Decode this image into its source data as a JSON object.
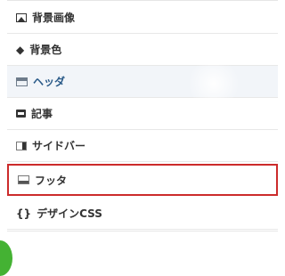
{
  "menu": {
    "items": [
      {
        "label": "背景画像",
        "icon": "image-icon"
      },
      {
        "label": "背景色",
        "icon": "paint-bucket-icon"
      },
      {
        "label": "ヘッダ",
        "icon": "header-layout-icon",
        "active": true
      },
      {
        "label": "記事",
        "icon": "article-icon"
      },
      {
        "label": "サイドバー",
        "icon": "sidebar-layout-icon"
      },
      {
        "label": "フッタ",
        "icon": "footer-layout-icon",
        "highlighted": true
      },
      {
        "label": "デザインCSS",
        "icon": "code-braces-icon"
      }
    ],
    "colors": {
      "active_text": "#2a5a88",
      "highlight_border": "#cc2b2b"
    }
  },
  "icons": {
    "bucket_glyph": "◆",
    "code_glyph": "{}"
  }
}
